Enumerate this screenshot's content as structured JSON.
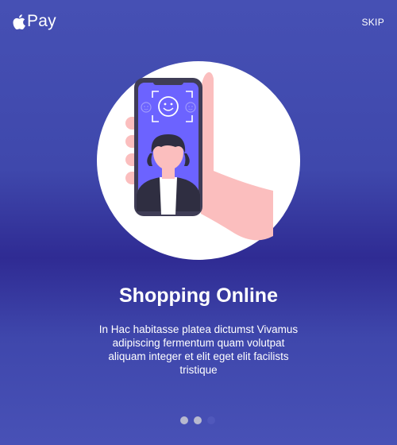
{
  "brand": {
    "name": "Pay",
    "logo_icon": "apple-logo-icon"
  },
  "header": {
    "skip_label": "SKIP"
  },
  "slide": {
    "illustration_icon": "phone-face-id-illustration",
    "title": "Shopping Online",
    "description": "In Hac habitasse platea dictumst Vivamus adipiscing fermentum quam volutpat aliquam integer et elit eget elit facilists tristique"
  },
  "pagination": {
    "total": 3,
    "active_index": 2
  },
  "colors": {
    "background": "#3f48ac",
    "dot_inactive": "#b7b9cf",
    "dot_active": "#5058bb",
    "phone_screen": "#6c63ff",
    "hand": "#fbbebe"
  }
}
